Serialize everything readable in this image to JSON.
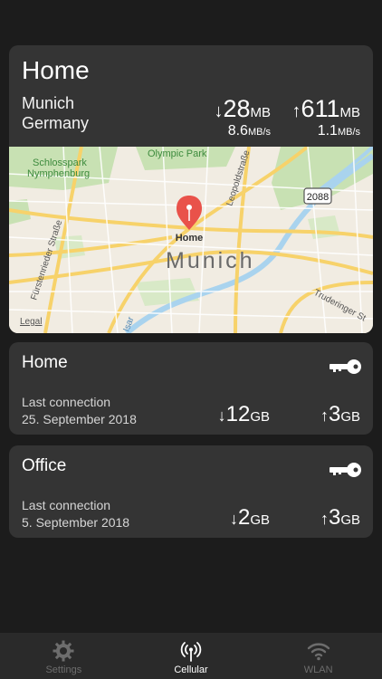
{
  "main": {
    "title": "Home",
    "city": "Munich",
    "country": "Germany",
    "download": {
      "arrow": "↓",
      "value": "28",
      "unit": "MB",
      "rate": "8.6",
      "rate_unit": "MB/s"
    },
    "upload": {
      "arrow": "↑",
      "value": "611",
      "unit": "MB",
      "rate": "1.1",
      "rate_unit": "MB/s"
    },
    "map": {
      "city_label": "Munich",
      "pin_label": "Home",
      "labels": {
        "schlosspark_1": "Schlosspark",
        "schlosspark_2": "Nymphenburg",
        "olympic_park": "Olympic Park",
        "leopoldstrasse": "Leopoldstraße",
        "fuerstenrieder": "Fürstenrieder Straße",
        "truderinger": "Truderinger St",
        "isar": "Isar",
        "road_badge": "2088",
        "legal": "Legal"
      },
      "colors": {
        "pin": "#e9524a",
        "park": "#c8e1b3",
        "road": "#f7d26a",
        "water": "#a9d3ee"
      }
    }
  },
  "connections": [
    {
      "name": "Home",
      "last_label": "Last connection",
      "date": "25. September 2018",
      "down_arrow": "↓",
      "down_value": "12",
      "down_unit": "GB",
      "up_arrow": "↑",
      "up_value": "3",
      "up_unit": "GB"
    },
    {
      "name": "Office",
      "last_label": "Last connection",
      "date": "5. September 2018",
      "down_arrow": "↓",
      "down_value": "2",
      "down_unit": "GB",
      "up_arrow": "↑",
      "up_value": "3",
      "up_unit": "GB"
    }
  ],
  "tabbar": {
    "tabs": [
      {
        "label": "Settings",
        "icon": "gear-icon"
      },
      {
        "label": "Cellular",
        "icon": "antenna-icon"
      },
      {
        "label": "WLAN",
        "icon": "wifi-icon"
      }
    ],
    "active": "Cellular"
  }
}
